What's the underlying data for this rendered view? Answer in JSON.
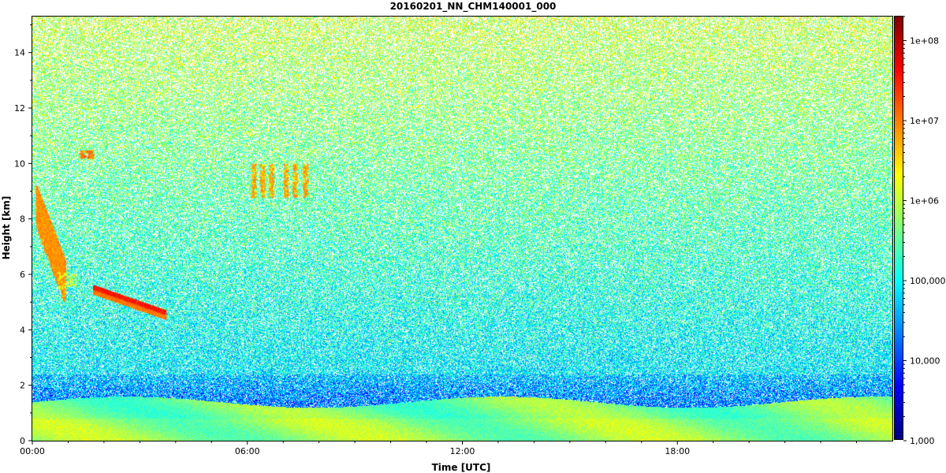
{
  "chart_data": {
    "type": "heatmap",
    "title": "20160201_NN_CHM140001_000",
    "xlabel": "Time [UTC]",
    "ylabel": "Height [km]",
    "x_range_hours": [
      0,
      24
    ],
    "y_range_km": [
      0,
      15.3
    ],
    "x_ticks": [
      {
        "value": 0,
        "label": "00:00"
      },
      {
        "value": 6,
        "label": "06:00"
      },
      {
        "value": 12,
        "label": "12:00"
      },
      {
        "value": 18,
        "label": "18:00"
      }
    ],
    "y_ticks": [
      {
        "value": 0,
        "label": "0"
      },
      {
        "value": 2,
        "label": "2"
      },
      {
        "value": 4,
        "label": "4"
      },
      {
        "value": 6,
        "label": "6"
      },
      {
        "value": 8,
        "label": "8"
      },
      {
        "value": 10,
        "label": "10"
      },
      {
        "value": 12,
        "label": "12"
      },
      {
        "value": 14,
        "label": "14"
      }
    ],
    "colorbar": {
      "scale": "log",
      "range": [
        1000,
        200000000
      ],
      "colors": [
        "#00007f",
        "#0000ff",
        "#0080ff",
        "#00ffff",
        "#80ff80",
        "#ffff00",
        "#ff8000",
        "#ff0000",
        "#7f0000"
      ],
      "ticks": [
        {
          "value": 1000,
          "label": "1,000"
        },
        {
          "value": 10000,
          "label": "10,000"
        },
        {
          "value": 100000,
          "label": "100,000"
        },
        {
          "value": 1000000,
          "label": "1e+06"
        },
        {
          "value": 10000000,
          "label": "1e+07"
        },
        {
          "value": 100000000,
          "label": "1e+08"
        }
      ]
    },
    "features": [
      {
        "name": "boundary layer",
        "t_start": 0,
        "t_end": 24,
        "z_bottom": 0,
        "z_top": 1.4,
        "value": 800000
      },
      {
        "name": "cloud layer",
        "t_start": 1.7,
        "t_end": 3.7,
        "z_top_start": 5.6,
        "z_top_end": 4.7,
        "value": 30000000
      },
      {
        "name": "falling streak",
        "t_start": 0.1,
        "t_end": 0.9,
        "z_top_start": 9.2,
        "z_top_end": 6.5,
        "value": 8000000
      },
      {
        "name": "cirrus patches",
        "t_start": 6.0,
        "t_end": 7.6,
        "z_bottom": 8.8,
        "z_top": 10.0,
        "value": 6000000
      },
      {
        "name": "cloud patch",
        "t_start": 1.3,
        "t_end": 1.7,
        "z_bottom": 10.2,
        "z_top": 10.5,
        "value": 10000000
      }
    ]
  }
}
